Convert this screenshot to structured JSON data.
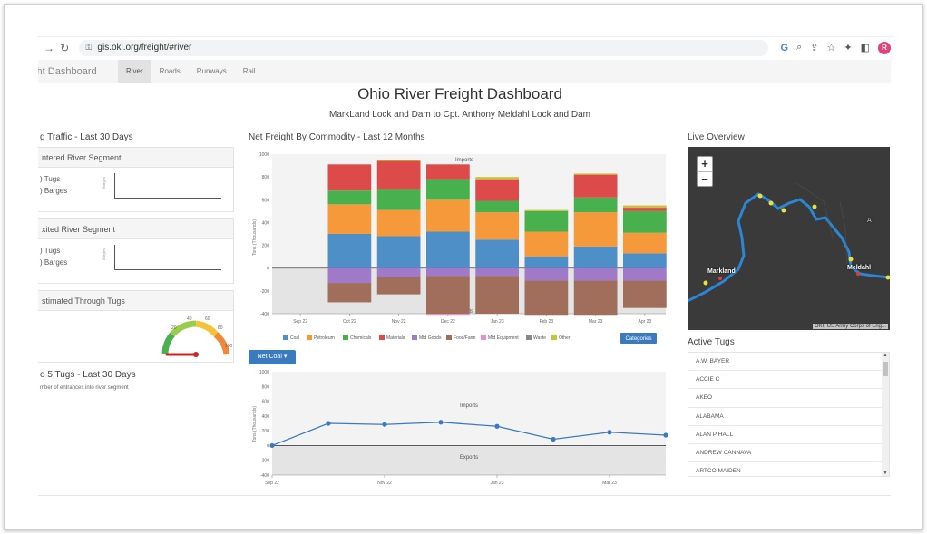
{
  "browser": {
    "url": "gis.oki.org/freight/#river",
    "avatar_letter": "R",
    "right_icons": [
      "G",
      "zoom-icon",
      "share-icon",
      "star-icon",
      "extensions-icon",
      "sidebar-icon"
    ]
  },
  "nav": {
    "brand": "ight Dashboard",
    "tabs": [
      {
        "label": "River",
        "active": true
      },
      {
        "label": "Roads",
        "active": false
      },
      {
        "label": "Runways",
        "active": false
      },
      {
        "label": "Rail",
        "active": false
      }
    ]
  },
  "page": {
    "title": "Ohio River Freight Dashboard",
    "subtitle": "MarkLand Lock and Dam to Cpt. Anthony Meldahl Lock and Dam"
  },
  "left": {
    "heading": "g Traffic - Last 30 Days",
    "entered": {
      "title": "ntered River Segment",
      "tugs": ") Tugs",
      "barges": ") Barges",
      "axis": "Barges"
    },
    "exited": {
      "title": "xited River Segment",
      "tugs": ") Tugs",
      "barges": ") Barges",
      "axis": "Barges"
    },
    "through": {
      "title": "stimated Through Tugs",
      "gauge_ticks": [
        "20",
        "40",
        "60",
        "80",
        "100"
      ],
      "gauge_end": "100"
    },
    "top5": {
      "title": "o 5 Tugs - Last 30 Days",
      "note": "mber of entrances into river segment"
    }
  },
  "center": {
    "heading": "Net Freight By Commodity - Last 12 Months",
    "dropdown": "Net Coal ▾",
    "categories_button": "Categories",
    "imports_label": "Imports",
    "exports_label": "Exports",
    "ylabel": "Tons (Thousands)"
  },
  "chart_data": [
    {
      "type": "bar",
      "stacked": true,
      "ylim": [
        -400,
        1000
      ],
      "yticks": [
        1000,
        800,
        600,
        400,
        200,
        0,
        -200,
        -400
      ],
      "x_ticks": [
        "Sep 22",
        "Oct 22",
        "Nov 22",
        "Dec 22",
        "Jan 23",
        "Feb 23",
        "Mar 23",
        "Apr 23"
      ],
      "categories": [
        "Oct 22",
        "Nov 22",
        "Dec 22",
        "Jan 23",
        "Feb 23",
        "Mar 23",
        "Apr 23"
      ],
      "series": [
        {
          "name": "Coal",
          "color": "#4e8fc7",
          "values": [
            300,
            280,
            320,
            250,
            100,
            190,
            130
          ]
        },
        {
          "name": "Petroleum",
          "color": "#f5993a",
          "values": [
            260,
            230,
            280,
            240,
            220,
            300,
            180
          ]
        },
        {
          "name": "Chemicals",
          "color": "#48b04d",
          "values": [
            120,
            180,
            180,
            100,
            180,
            130,
            190
          ]
        },
        {
          "name": "Materials",
          "color": "#dd4a4a",
          "values": [
            230,
            250,
            130,
            190,
            0,
            200,
            30
          ]
        },
        {
          "name": "Mfd Goods",
          "color": "#a07ac9",
          "values": [
            -130,
            -80,
            -70,
            -70,
            -110,
            -110,
            -110
          ]
        },
        {
          "name": "Food/Farm",
          "color": "#a06e5a",
          "values": [
            -170,
            -150,
            -330,
            -330,
            -300,
            -300,
            -240
          ]
        },
        {
          "name": "Mfd Equipment",
          "color": "#e88fc9",
          "values": [
            0,
            0,
            -10,
            0,
            0,
            0,
            0
          ]
        },
        {
          "name": "Waste",
          "color": "#888888",
          "values": [
            0,
            0,
            0,
            0,
            0,
            0,
            0
          ]
        },
        {
          "name": "Other",
          "color": "#c7c43a",
          "values": [
            0,
            10,
            0,
            20,
            10,
            10,
            20
          ]
        }
      ]
    },
    {
      "type": "line",
      "ylim": [
        -400,
        1000
      ],
      "yticks": [
        1000,
        800,
        600,
        400,
        200,
        0,
        -200,
        -400
      ],
      "x_ticks": [
        "Sep 22",
        "Nov 22",
        "Jan 23",
        "Mar 23"
      ],
      "x": [
        "Sep 22",
        "Oct 22",
        "Nov 22",
        "Dec 22",
        "Jan 23",
        "Feb 23",
        "Mar 23",
        "Apr 23"
      ],
      "series": [
        {
          "color": "#3a7bbf",
          "values": [
            0,
            300,
            285,
            315,
            260,
            85,
            180,
            140
          ]
        }
      ]
    }
  ],
  "right": {
    "live_heading": "Live Overview",
    "map_labels": {
      "markland": "Markland",
      "meldahl": "Meldahl",
      "ax": "A"
    },
    "attribution": "OKI, US Army Corps of Eng...",
    "zoom_in": "+",
    "zoom_out": "−",
    "tugs_heading": "Active Tugs",
    "tugs": [
      "A.W. BAYER",
      "ACCIE C",
      "AKEO",
      "ALABAMA",
      "ALAN P HALL",
      "ANDREW CANNAVA",
      "ARTCO MAIDEN"
    ]
  }
}
